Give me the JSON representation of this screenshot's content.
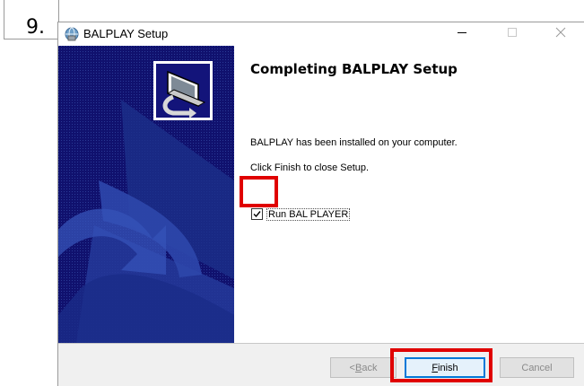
{
  "step": {
    "number": "9."
  },
  "window": {
    "title": "BALPLAY Setup",
    "controls": {
      "minimize_icon": "minimize-icon",
      "maximize_icon": "maximize-icon",
      "close_icon": "close-icon"
    }
  },
  "content": {
    "heading": "Completing BALPLAY Setup",
    "message1": "BALPLAY has been installed on your computer.",
    "message2": "Click Finish to close Setup.",
    "run_checkbox": {
      "label": "Run BAL PLAYER",
      "checked": true
    }
  },
  "buttons": {
    "back": {
      "mnemonic": "B",
      "rest": "ack",
      "prefix": "< "
    },
    "finish": {
      "mnemonic": "F",
      "rest": "inish"
    },
    "cancel": "Cancel"
  },
  "colors": {
    "side_panel": "#10116e",
    "highlight": "#e00000",
    "default_button_border": "#0078d7"
  }
}
